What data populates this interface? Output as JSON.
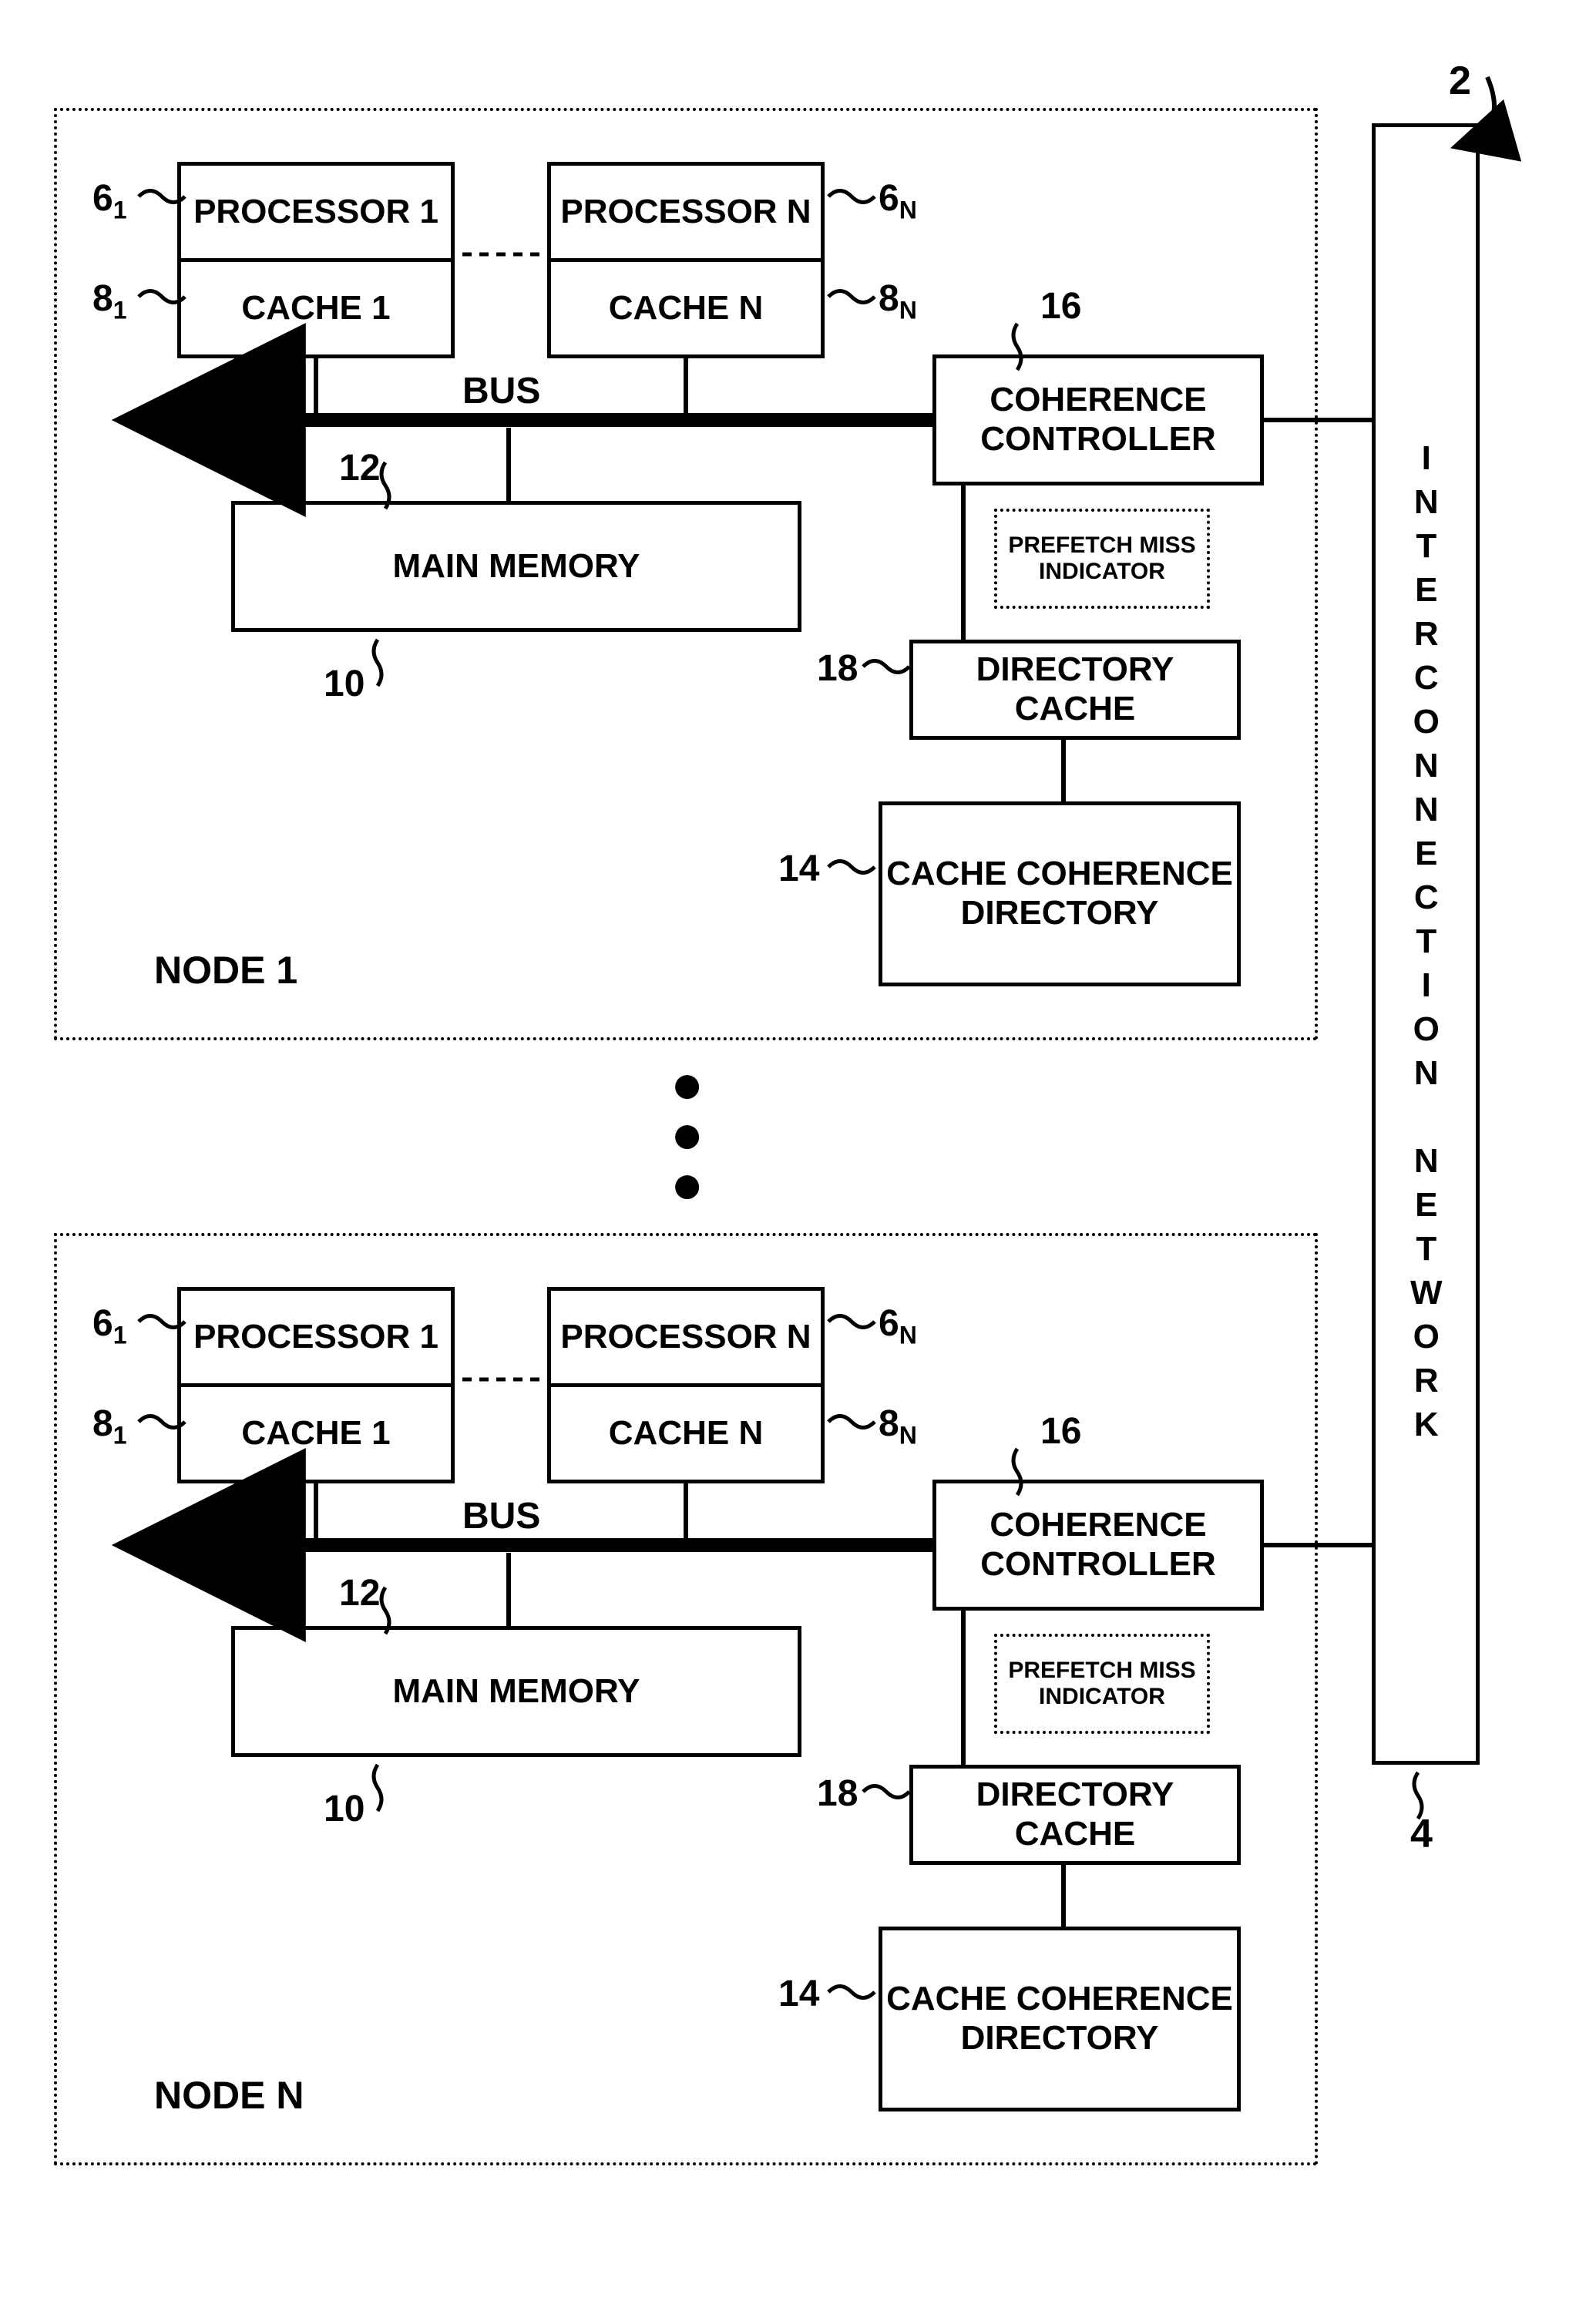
{
  "system_ref": "2",
  "interconnect": {
    "ref": "4",
    "label": "INTERCONNECTION NETWORK"
  },
  "nodes": [
    {
      "title": "NODE 1",
      "processors": [
        {
          "label": "PROCESSOR\n1",
          "ref_label": "6",
          "ref_sub": "1"
        },
        {
          "label": "PROCESSOR\nN",
          "ref_label": "6",
          "ref_sub": "N"
        }
      ],
      "caches": [
        {
          "label": "CACHE\n1",
          "ref_label": "8",
          "ref_sub": "1"
        },
        {
          "label": "CACHE\nN",
          "ref_label": "8",
          "ref_sub": "N"
        }
      ],
      "bus_label": "BUS",
      "bus_ref": "12",
      "main_memory": {
        "label": "MAIN\nMEMORY",
        "ref": "10"
      },
      "coherence_controller": {
        "label": "COHERENCE\nCONTROLLER",
        "ref": "16"
      },
      "prefetch_box": {
        "label": "PREFETCH\nMISS\nINDICATOR"
      },
      "directory_cache": {
        "label": "DIRECTORY\nCACHE",
        "ref": "18"
      },
      "cache_coherence_dir": {
        "label": "CACHE\nCOHERENCE\nDIRECTORY",
        "ref": "14"
      }
    },
    {
      "title": "NODE N",
      "processors": [
        {
          "label": "PROCESSOR\n1",
          "ref_label": "6",
          "ref_sub": "1"
        },
        {
          "label": "PROCESSOR\nN",
          "ref_label": "6",
          "ref_sub": "N"
        }
      ],
      "caches": [
        {
          "label": "CACHE\n1",
          "ref_label": "8",
          "ref_sub": "1"
        },
        {
          "label": "CACHE\nN",
          "ref_label": "8",
          "ref_sub": "N"
        }
      ],
      "bus_label": "BUS",
      "bus_ref": "12",
      "main_memory": {
        "label": "MAIN\nMEMORY",
        "ref": "10"
      },
      "coherence_controller": {
        "label": "COHERENCE\nCONTROLLER",
        "ref": "16"
      },
      "prefetch_box": {
        "label": "PREFETCH\nMISS\nINDICATOR"
      },
      "directory_cache": {
        "label": "DIRECTORY\nCACHE",
        "ref": "18"
      },
      "cache_coherence_dir": {
        "label": "CACHE\nCOHERENCE\nDIRECTORY",
        "ref": "14"
      }
    }
  ]
}
